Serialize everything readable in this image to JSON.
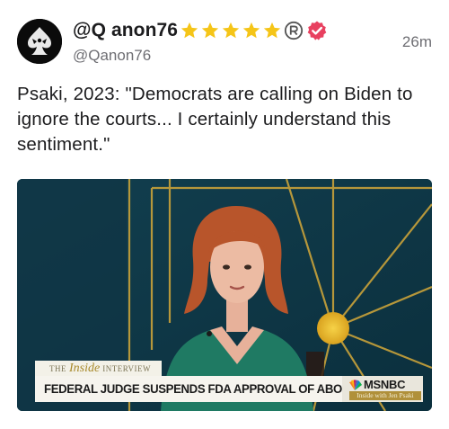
{
  "post": {
    "display_name": "@Q anon76",
    "handle": "@Qanon76",
    "timestamp": "26m",
    "body": "Psaki, 2023: \"Democrats are calling on Biden to ignore the courts... I certainly understand this sentiment.\"",
    "badges": {
      "star_count": 5,
      "star_color": "#f5c518",
      "verified_color": "#e8405f",
      "registered_icon": "registered-mark-icon"
    }
  },
  "video": {
    "segment": {
      "the": "THE",
      "inside": "Inside",
      "interview": "INTERVIEW"
    },
    "headline": "FEDERAL JUDGE SUSPENDS FDA APPROVAL OF ABORTION PILL",
    "network": "MSNBC",
    "show_name": "Inside with Jen Psaki",
    "colors": {
      "backdrop": "#0f3a4a",
      "gold_lines": "#c9a23a",
      "sun": "#e0b52e",
      "dress": "#1f7a63",
      "hair": "#b8552b"
    }
  }
}
